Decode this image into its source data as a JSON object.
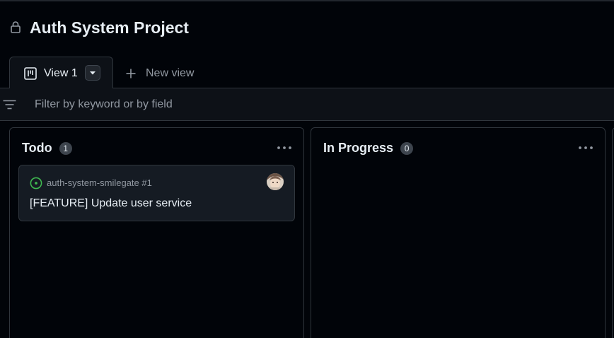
{
  "project": {
    "title": "Auth System Project",
    "visibility_icon": "lock-icon"
  },
  "tabs": {
    "active_label": "View 1",
    "active_icon": "board-icon",
    "new_view_label": "New view"
  },
  "filter": {
    "icon": "filter-icon",
    "placeholder": "Filter by keyword or by field",
    "value": ""
  },
  "columns": [
    {
      "title": "Todo",
      "count": "1",
      "cards": [
        {
          "status_icon": "issue-open-icon",
          "ref": "auth-system-smilegate #1",
          "title": "[FEATURE] Update user service",
          "assignee_icon": "avatar"
        }
      ]
    },
    {
      "title": "In Progress",
      "count": "0",
      "cards": []
    }
  ],
  "colors": {
    "background": "#010409",
    "surface": "#0d1117",
    "card": "#151b23",
    "border": "#30363d",
    "text": "#e6edf3",
    "muted": "#9198a1",
    "open_issue": "#3fb950"
  }
}
